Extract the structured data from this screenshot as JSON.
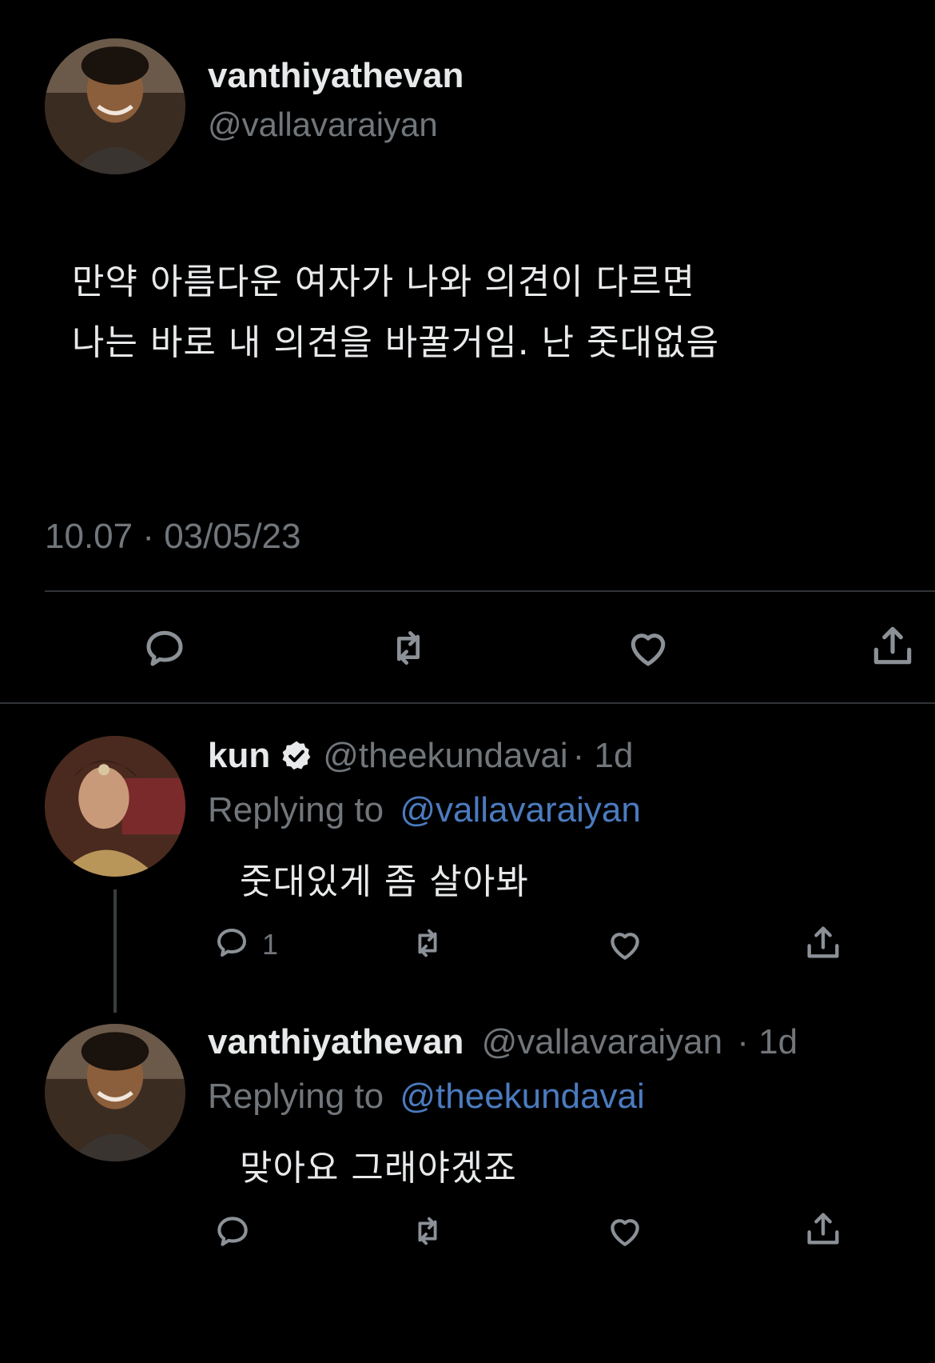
{
  "main_tweet": {
    "display_name": "vanthiyathevan",
    "handle": "@vallavaraiyan",
    "text_line1": "만약 아름다운 여자가 나와 의견이 다르면",
    "text_line2": "나는 바로 내 의견을 바꿀거임. 난 줏대없음",
    "timestamp": "10.07 · 03/05/23"
  },
  "reply1": {
    "display_name": "kun",
    "handle": "@theekundavai",
    "age": "· 1d",
    "replying_label": "Replying to",
    "replying_handle": "@vallavaraiyan",
    "text": "줏대있게 좀 살아봐",
    "reply_count": "1"
  },
  "reply2": {
    "display_name": "vanthiyathevan",
    "handle": "@vallavaraiyan",
    "age": "· 1d",
    "replying_label": "Replying to",
    "replying_handle": "@theekundavai",
    "text": "맞아요 그래야겠죠"
  },
  "icons": {
    "reply": "reply-bubble-icon",
    "retweet": "retweet-icon",
    "like": "heart-icon",
    "share": "share-upload-icon",
    "verified": "verified-badge-icon"
  },
  "colors": {
    "background": "#000000",
    "text": "#e7e9ea",
    "muted": "#71767b",
    "link": "#4b7bbf",
    "divider": "#2f3336"
  }
}
